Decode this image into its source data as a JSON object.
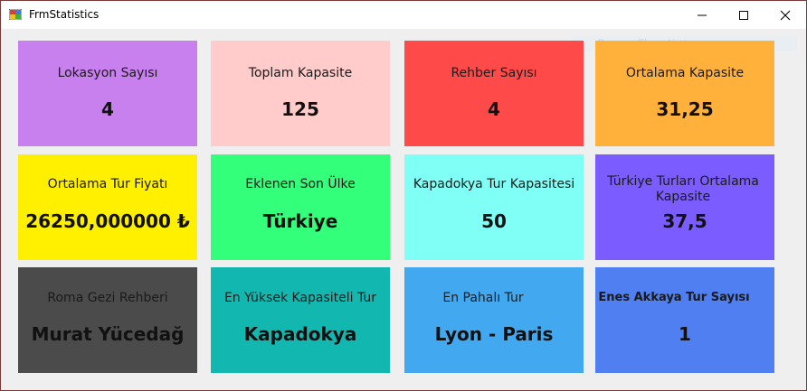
{
  "window": {
    "title": "FrmStatistics",
    "ghost_text": "Pencere Ekran Alıntısı"
  },
  "colors": {
    "purple": "#c880ee",
    "pink": "#ffcccb",
    "red": "#ff4a4a",
    "orange": "#ffb13b",
    "yellow": "#fff000",
    "green": "#33ff7a",
    "cyan": "#80fff7",
    "violet": "#7b5cff",
    "dark": "#4b4b4b",
    "teal": "#12b8b0",
    "blue": "#42a9f0",
    "royal": "#4f7ff0"
  },
  "cards": [
    {
      "label": "Lokasyon Sayısı",
      "value": "4"
    },
    {
      "label": "Toplam Kapasite",
      "value": "125"
    },
    {
      "label": "Rehber Sayısı",
      "value": "4"
    },
    {
      "label": "Ortalama Kapasite",
      "value": "31,25"
    },
    {
      "label": "Ortalama Tur Fiyatı",
      "value": "26250,000000 ₺"
    },
    {
      "label": "Eklenen Son Ülke",
      "value": "Türkiye"
    },
    {
      "label": "Kapadokya Tur Kapasitesi",
      "value": "50"
    },
    {
      "label": "Türkiye Turları Ortalama Kapasite",
      "value": "37,5"
    },
    {
      "label": "Roma Gezi Rehberi",
      "value": "Murat Yücedağ"
    },
    {
      "label": "En Yüksek Kapasiteli Tur",
      "value": "Kapadokya"
    },
    {
      "label": "En Pahalı Tur",
      "value": "Lyon - Paris"
    },
    {
      "label": "Enes Akkaya Tur Sayısı",
      "value": "1"
    }
  ]
}
